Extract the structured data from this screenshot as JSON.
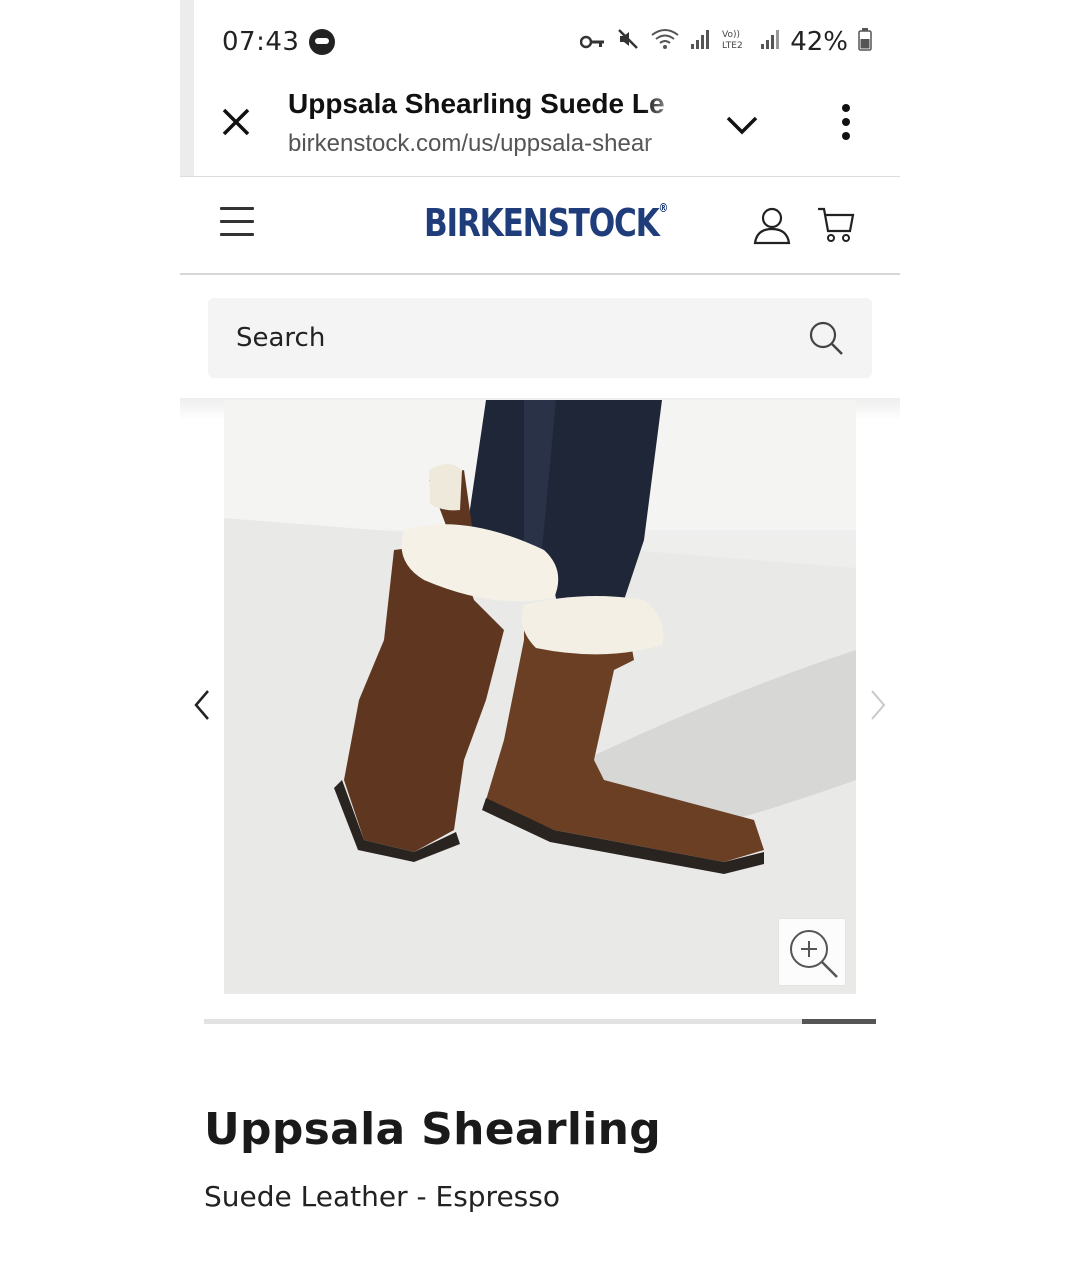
{
  "status_bar": {
    "time": "07:43",
    "battery": "42%",
    "volte_label": "Vo)) LTE2"
  },
  "custom_tab": {
    "title": "Uppsala Shearling Suede Le",
    "url": "birkenstock.com/us/uppsala-shear",
    "icons": [
      "close-icon",
      "chevron-down-icon",
      "more-vertical-icon"
    ]
  },
  "site_header": {
    "logo": "BIRKENSTOCK",
    "logo_mark": "®",
    "icons": [
      "menu-icon",
      "account-icon",
      "cart-icon"
    ],
    "brand_color": "#1f3d7a"
  },
  "search": {
    "placeholder": "Search"
  },
  "gallery": {
    "image_subject": "brown suede shearling-lined boots",
    "progress": {
      "start": 0.89,
      "end": 1.0
    }
  },
  "product": {
    "name": "Uppsala Shearling",
    "variant": "Suede Leather - Espresso"
  }
}
